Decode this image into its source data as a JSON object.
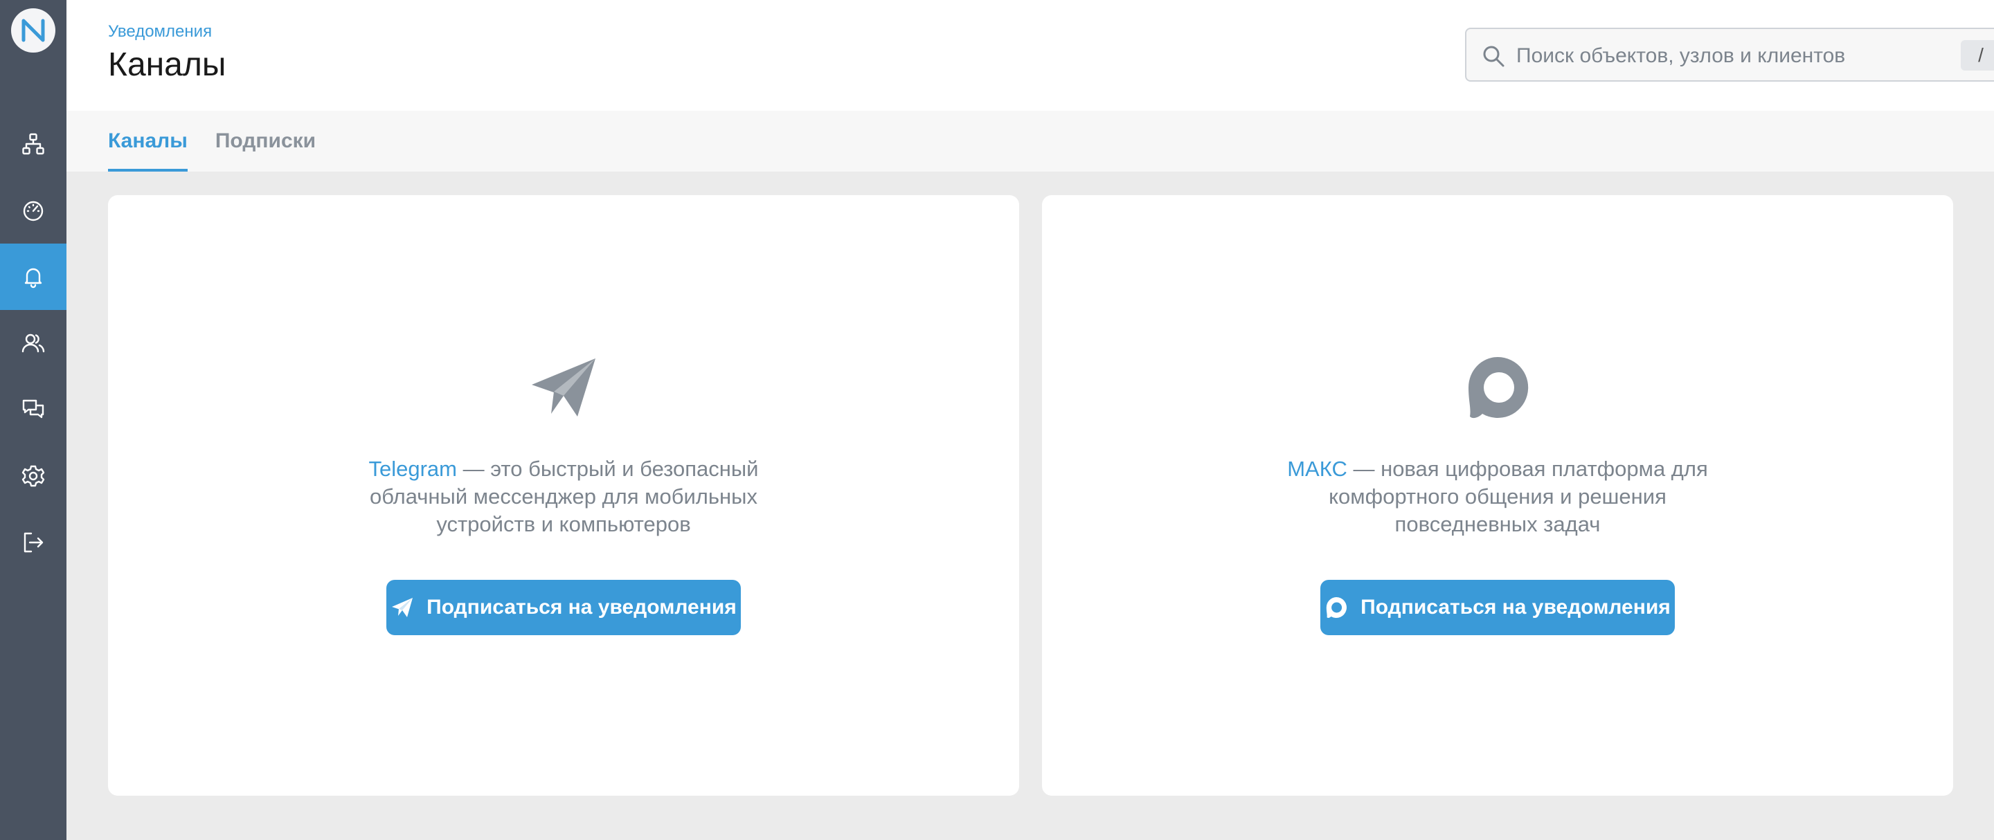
{
  "sidebar": {
    "logo_letter": "N",
    "items": [
      {
        "name": "network",
        "icon": "network-icon",
        "active": false
      },
      {
        "name": "dashboard",
        "icon": "gauge-icon",
        "active": false
      },
      {
        "name": "notifications",
        "icon": "bell-icon",
        "active": true
      },
      {
        "name": "users",
        "icon": "users-icon",
        "active": false
      },
      {
        "name": "chat",
        "icon": "chat-icon",
        "active": false
      },
      {
        "name": "settings",
        "icon": "gear-icon",
        "active": false
      },
      {
        "name": "logout",
        "icon": "logout-icon",
        "active": false
      }
    ]
  },
  "header": {
    "breadcrumb": "Уведомления",
    "title": "Каналы",
    "search": {
      "placeholder": "Поиск объектов, узлов и клиентов",
      "value": "",
      "shortcut": "/"
    }
  },
  "tabs": [
    {
      "label": "Каналы",
      "active": true
    },
    {
      "label": "Подписки",
      "active": false
    }
  ],
  "channels": [
    {
      "icon": "telegram-icon",
      "brand": "Telegram",
      "description_1": " — это быстрый и безопасный",
      "description_2": "облачный мессенджер для мобильных",
      "description_3": "устройств и компьютеров",
      "button_label": "Подписаться на уведомления"
    },
    {
      "icon": "max-icon",
      "brand": "МАКС",
      "description_1": " — новая цифровая платформа для",
      "description_2": "комфортного общения и решения",
      "description_3": "повседневных задач",
      "button_label": "Подписаться на уведомления"
    }
  ],
  "colors": {
    "accent": "#3a9ad8",
    "sidebar": "#4a5361",
    "muted_text": "#7c848d",
    "icon_gray": "#8a929b"
  }
}
